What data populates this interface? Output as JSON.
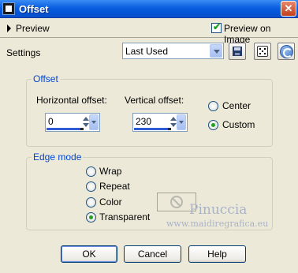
{
  "window": {
    "title": "Offset",
    "close_glyph": "✕"
  },
  "top_row": {
    "preview_label": "Preview",
    "preview_on_image_label": "Preview on Image",
    "preview_on_image_checked": true
  },
  "settings": {
    "label": "Settings",
    "selected": "Last Used",
    "icons": [
      "save-preset-icon",
      "randomize-dice-icon",
      "reset-icon"
    ]
  },
  "offset_group": {
    "title": "Offset",
    "horizontal_label": "Horizontal offset:",
    "horizontal_value": "0",
    "vertical_label": "Vertical offset:",
    "vertical_value": "230",
    "mode_options": [
      "Center",
      "Custom"
    ],
    "mode_selected": "Custom"
  },
  "edge_group": {
    "title": "Edge mode",
    "options": [
      "Wrap",
      "Repeat",
      "Color",
      "Transparent"
    ],
    "selected": "Transparent"
  },
  "watermark": {
    "line1": "Pinuccia",
    "line2": "www.maidiregrafica.eu"
  },
  "buttons": {
    "ok": "OK",
    "cancel": "Cancel",
    "help": "Help"
  },
  "colors": {
    "title_bar": "#0a5fe0",
    "group_title": "#0046d5",
    "dialog_bg": "#ece9d8",
    "radio_dot": "#21a121"
  }
}
